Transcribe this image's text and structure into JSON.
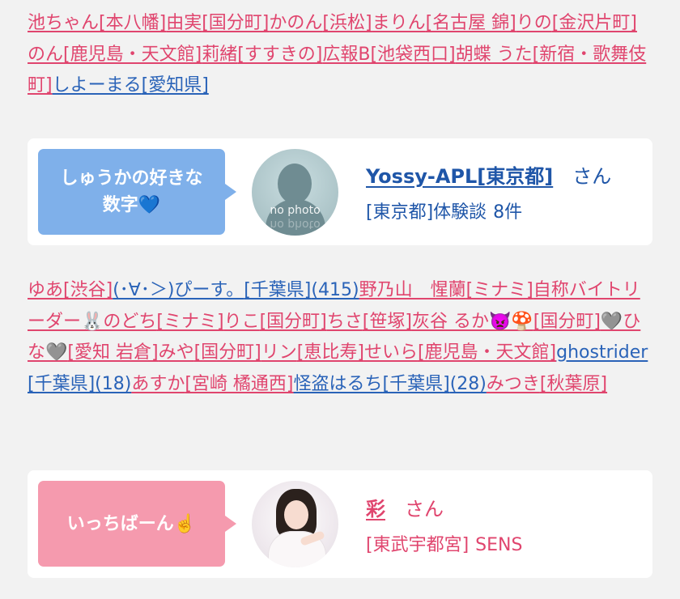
{
  "links_top": [
    {
      "text": "池ちゃん",
      "color": "pink"
    },
    {
      "text": "[本八幡]",
      "color": "pink"
    },
    {
      "text": "由実",
      "color": "pink"
    },
    {
      "text": "[国分町]",
      "color": "pink"
    },
    {
      "text": "かのん",
      "color": "pink"
    },
    {
      "text": "[浜松]",
      "color": "pink"
    },
    {
      "text": "まりん",
      "color": "pink"
    },
    {
      "text": "[名古屋 錦]",
      "color": "pink"
    },
    {
      "text": "りの",
      "color": "pink"
    },
    {
      "text": "[金沢片町]",
      "color": "pink"
    },
    {
      "text": "のん",
      "color": "pink"
    },
    {
      "text": "[鹿児島・天文館]",
      "color": "pink"
    },
    {
      "text": "莉緒",
      "color": "pink"
    },
    {
      "text": "[すすきの]",
      "color": "pink"
    },
    {
      "text": "広報B",
      "color": "pink"
    },
    {
      "text": "[池袋西口]",
      "color": "pink"
    },
    {
      "text": "胡蝶 うた",
      "color": "pink"
    },
    {
      "text": "[新宿・歌舞伎町]",
      "color": "pink"
    },
    {
      "text": "しよーまる",
      "color": "blue"
    },
    {
      "text": "[愛知県]",
      "color": "blue"
    }
  ],
  "card_1": {
    "bubble_text_1": "しゅうかの好きな",
    "bubble_text_2": "数字💙",
    "avatar_label": "no photo",
    "username": "Yossy-APL[東京都]",
    "honorific": "さん",
    "location": "[東京都]体験談",
    "count": "8件"
  },
  "links_bottom": [
    {
      "text": "ゆあ",
      "color": "pink"
    },
    {
      "text": "[渋谷]",
      "color": "pink"
    },
    {
      "text": "(･∀･＞)ぴーす。",
      "color": "blue"
    },
    {
      "text": "[千葉県]",
      "color": "blue"
    },
    {
      "text": "(415)",
      "color": "blue"
    },
    {
      "text": "野乃山　惺蘭",
      "color": "pink"
    },
    {
      "text": "[ミナミ]",
      "color": "pink"
    },
    {
      "text": "自称バイトリーダー🐰のどち",
      "color": "pink"
    },
    {
      "text": "[ミナミ]",
      "color": "pink"
    },
    {
      "text": "りこ",
      "color": "pink"
    },
    {
      "text": "[国分町]",
      "color": "pink"
    },
    {
      "text": "ちさ",
      "color": "pink"
    },
    {
      "text": "[笹塚]",
      "color": "pink"
    },
    {
      "text": "灰谷 るか👿🍄",
      "color": "pink"
    },
    {
      "text": "[国分町]",
      "color": "pink"
    },
    {
      "text": "🩶ひな🩶",
      "color": "pink"
    },
    {
      "text": "[愛知 岩倉]",
      "color": "pink"
    },
    {
      "text": "みや",
      "color": "pink"
    },
    {
      "text": "[国分町]",
      "color": "pink"
    },
    {
      "text": "リン",
      "color": "pink"
    },
    {
      "text": "[恵比寿]",
      "color": "pink"
    },
    {
      "text": "せいら",
      "color": "pink"
    },
    {
      "text": "[鹿児島・天文館]",
      "color": "pink"
    },
    {
      "text": "ghostrider",
      "color": "blue"
    },
    {
      "text": "[千葉県]",
      "color": "blue"
    },
    {
      "text": "(18)",
      "color": "blue"
    },
    {
      "text": "あすか",
      "color": "pink"
    },
    {
      "text": "[宮崎 橘通西]",
      "color": "pink"
    },
    {
      "text": "怪盗はるち",
      "color": "blue"
    },
    {
      "text": "[千葉県]",
      "color": "blue"
    },
    {
      "text": "(28)",
      "color": "blue"
    },
    {
      "text": "みつき",
      "color": "pink"
    },
    {
      "text": "[秋葉原]",
      "color": "pink"
    }
  ],
  "card_2": {
    "bubble_text": "いっちばーん☝️",
    "username": "彩",
    "honorific": "さん",
    "location": "[東武宇都宮]",
    "shop": "SENS"
  },
  "colors": {
    "link_pink": "#e0456e",
    "link_blue": "#2a63b8",
    "bubble_blue": "#7fb0ea",
    "bubble_pink": "#f59aae"
  }
}
